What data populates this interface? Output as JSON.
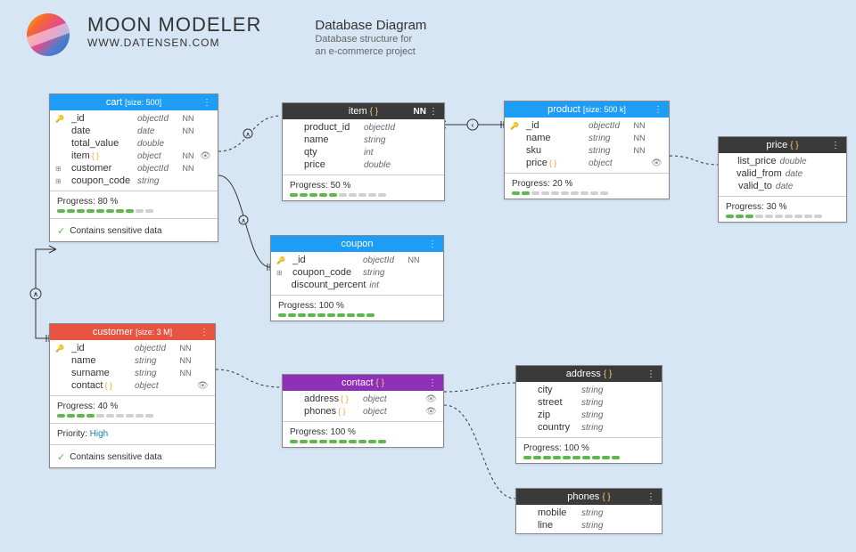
{
  "app": {
    "title": "MOON MODELER",
    "url": "WWW.DATENSEN.COM"
  },
  "doc": {
    "title": "Database Diagram",
    "desc1": "Database structure for",
    "desc2": "an e-commerce project"
  },
  "colors": {
    "cart": "#1e9df7",
    "item": "#3a3a3a",
    "coupon": "#1e9df7",
    "customer": "#e85442",
    "contact": "#8e30b8",
    "product": "#1e9df7",
    "price": "#3a3a3a",
    "address": "#3a3a3a",
    "phones": "#3a3a3a"
  },
  "entities": {
    "cart": {
      "name": "cart",
      "size": "[size: 500]",
      "fields": [
        {
          "icon": "key",
          "name": "_id",
          "type": "objectId",
          "nn": "NN"
        },
        {
          "icon": "",
          "name": "date",
          "type": "date",
          "nn": "NN"
        },
        {
          "icon": "",
          "name": "total_value",
          "type": "double",
          "nn": ""
        },
        {
          "icon": "",
          "name": "item",
          "br": "{ }",
          "type": "object",
          "nn": "NN",
          "eye": "1"
        },
        {
          "icon": "ref",
          "name": "customer",
          "type": "objectId",
          "nn": "NN"
        },
        {
          "icon": "ref",
          "name": "coupon_code",
          "type": "string",
          "nn": ""
        }
      ],
      "progress": 80,
      "note": "Contains sensitive data"
    },
    "item": {
      "name": "item",
      "br": "{ }",
      "nn": "NN",
      "fields": [
        {
          "icon": "",
          "name": "product_id",
          "type": "objectId",
          "nn": ""
        },
        {
          "icon": "",
          "name": "name",
          "type": "string",
          "nn": ""
        },
        {
          "icon": "",
          "name": "qty",
          "type": "int",
          "nn": ""
        },
        {
          "icon": "",
          "name": "price",
          "type": "double",
          "nn": ""
        }
      ],
      "progress": 50
    },
    "coupon": {
      "name": "coupon",
      "fields": [
        {
          "icon": "key",
          "name": "_id",
          "type": "objectId",
          "nn": "NN"
        },
        {
          "icon": "ref",
          "name": "coupon_code",
          "type": "string",
          "nn": ""
        },
        {
          "icon": "",
          "name": "discount_percent",
          "type": "int",
          "nn": ""
        }
      ],
      "progress": 100
    },
    "customer": {
      "name": "customer",
      "size": "[size: 3 M]",
      "fields": [
        {
          "icon": "key",
          "name": "_id",
          "type": "objectId",
          "nn": "NN"
        },
        {
          "icon": "",
          "name": "name",
          "type": "string",
          "nn": "NN"
        },
        {
          "icon": "",
          "name": "surname",
          "type": "string",
          "nn": "NN"
        },
        {
          "icon": "",
          "name": "contact",
          "br": "{ }",
          "type": "object",
          "nn": "",
          "eye": "1"
        }
      ],
      "progress": 40,
      "priority": "High",
      "note": "Contains sensitive data"
    },
    "contact": {
      "name": "contact",
      "br": "{ }",
      "fields": [
        {
          "icon": "",
          "name": "address",
          "br": "{ }",
          "type": "object",
          "nn": "",
          "eye": "1"
        },
        {
          "icon": "",
          "name": "phones",
          "br": "{ }",
          "type": "object",
          "nn": "",
          "eye": "1"
        }
      ],
      "progress": 100
    },
    "product": {
      "name": "product",
      "size": "[size: 500 k]",
      "fields": [
        {
          "icon": "key",
          "name": "_id",
          "type": "objectId",
          "nn": "NN"
        },
        {
          "icon": "",
          "name": "name",
          "type": "string",
          "nn": "NN"
        },
        {
          "icon": "",
          "name": "sku",
          "type": "string",
          "nn": "NN"
        },
        {
          "icon": "",
          "name": "price",
          "br": "{ }",
          "type": "object",
          "nn": "",
          "eye": "1"
        }
      ],
      "progress": 20
    },
    "price": {
      "name": "price",
      "br": "{ }",
      "fields": [
        {
          "icon": "",
          "name": "list_price",
          "type": "double",
          "nn": ""
        },
        {
          "icon": "",
          "name": "valid_from",
          "type": "date",
          "nn": ""
        },
        {
          "icon": "",
          "name": "valid_to",
          "type": "date",
          "nn": ""
        }
      ],
      "progress": 30
    },
    "address": {
      "name": "address",
      "br": "{ }",
      "fields": [
        {
          "icon": "",
          "name": "city",
          "type": "string",
          "nn": ""
        },
        {
          "icon": "",
          "name": "street",
          "type": "string",
          "nn": ""
        },
        {
          "icon": "",
          "name": "zip",
          "type": "string",
          "nn": ""
        },
        {
          "icon": "",
          "name": "country",
          "type": "string",
          "nn": ""
        }
      ],
      "progress": 100
    },
    "phones": {
      "name": "phones",
      "br": "{ }",
      "fields": [
        {
          "icon": "",
          "name": "mobile",
          "type": "string",
          "nn": ""
        },
        {
          "icon": "",
          "name": "line",
          "type": "string",
          "nn": ""
        }
      ]
    }
  },
  "labels": {
    "progress_prefix": "Progress: ",
    "progress_suffix": " %",
    "priority_prefix": "Priority: "
  }
}
